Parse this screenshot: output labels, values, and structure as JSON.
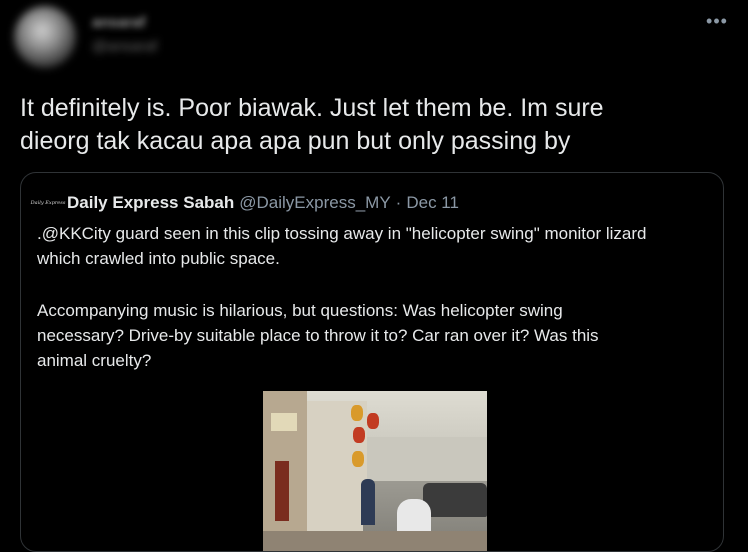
{
  "tweet": {
    "author_name": "ansaraf",
    "author_handle": "@ansaraf",
    "more_label": "•••",
    "text_line_1": "It definitely is. Poor biawak. Just let them be. Im sure",
    "text_line_2": "dieorg tak kacau apa apa pun but only passing by"
  },
  "quote": {
    "avatar_text": "Daily Express",
    "name": "Daily Express Sabah",
    "handle": "@DailyExpress_MY",
    "separator": "·",
    "date": "Dec 11",
    "line_1": ".@KKCity guard seen in this clip tossing away in \"helicopter swing\" monitor lizard",
    "line_2": "which crawled into public space.",
    "line_3": "Accompanying music is hilarious, but questions: Was helicopter swing",
    "line_4": "necessary? Drive-by suitable place to throw it to? Car ran over it? Was this",
    "line_5": "animal cruelty?"
  },
  "colors": {
    "background": "#000000",
    "text": "#e7e9ea",
    "secondary_text": "#8b98a5",
    "border": "#2f3336"
  }
}
